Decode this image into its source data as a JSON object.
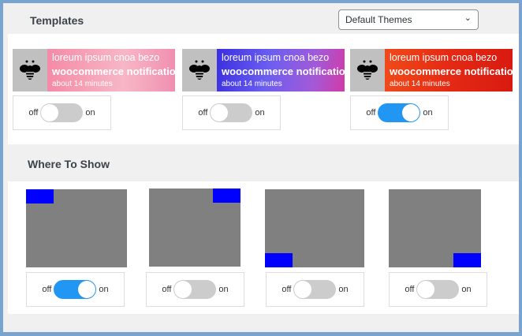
{
  "templates": {
    "title": "Templates",
    "select_value": "Default Themes",
    "cards": [
      {
        "line1": "loreum ipsum cnoa bezo",
        "line2": "woocommerce notification",
        "line3": "about 14 minutes",
        "bg": "linear-gradient(90deg,#f48aa6,#f7b7c6 60%,#f08fb0)",
        "toggle": false
      },
      {
        "line1": "loreum ipsum cnoa bezo",
        "line2": "woocommerce notification",
        "line3": "about 14 minutes",
        "bg": "linear-gradient(100deg,#3a2ee0,#6a5ef0 40%,#a25ad8 75%,#d23aa8)",
        "toggle": false
      },
      {
        "line1": "loreum ipsum cnoa bezo",
        "line2": "woocommerce notification",
        "line3": "about 14 minutes",
        "bg": "linear-gradient(90deg,#f04a1a,#e42a14 50%,#d81a10)",
        "toggle": true
      }
    ]
  },
  "where": {
    "title": "Where To Show",
    "positions": [
      {
        "name": "top-left",
        "toggle": true
      },
      {
        "name": "top-right",
        "toggle": false
      },
      {
        "name": "bottom-left",
        "toggle": false
      },
      {
        "name": "bottom-right",
        "toggle": false
      }
    ]
  },
  "toggle": {
    "off": "off",
    "on": "on"
  }
}
